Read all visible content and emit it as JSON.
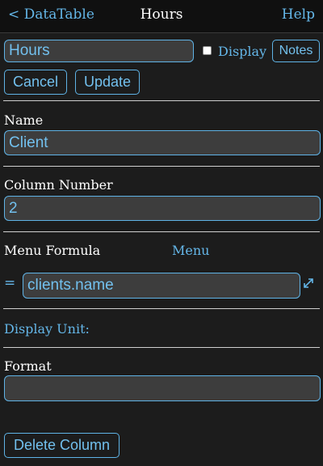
{
  "nav": {
    "back_label": "< DataTable",
    "title": "Hours",
    "help_label": "Help"
  },
  "header": {
    "column_name_value": "Hours",
    "display_label": "Display",
    "display_checked": false,
    "notes_label": "Notes",
    "cancel_label": "Cancel",
    "update_label": "Update"
  },
  "name_section": {
    "label": "Name",
    "value": "Client"
  },
  "column_number_section": {
    "label": "Column Number",
    "value": "2"
  },
  "menu_formula_section": {
    "label": "Menu Formula",
    "menu_link": "Menu",
    "equals": "=",
    "value": "clients.name",
    "expand_icon": "expand-arrows-icon"
  },
  "display_unit": {
    "label": "Display Unit:"
  },
  "format_section": {
    "label": "Format",
    "value": ""
  },
  "delete_label": "Delete Column",
  "colors": {
    "accent": "#64b6e8",
    "background": "#1c1c1c",
    "topbar": "#101010",
    "field_bg": "#3d3d3d"
  }
}
